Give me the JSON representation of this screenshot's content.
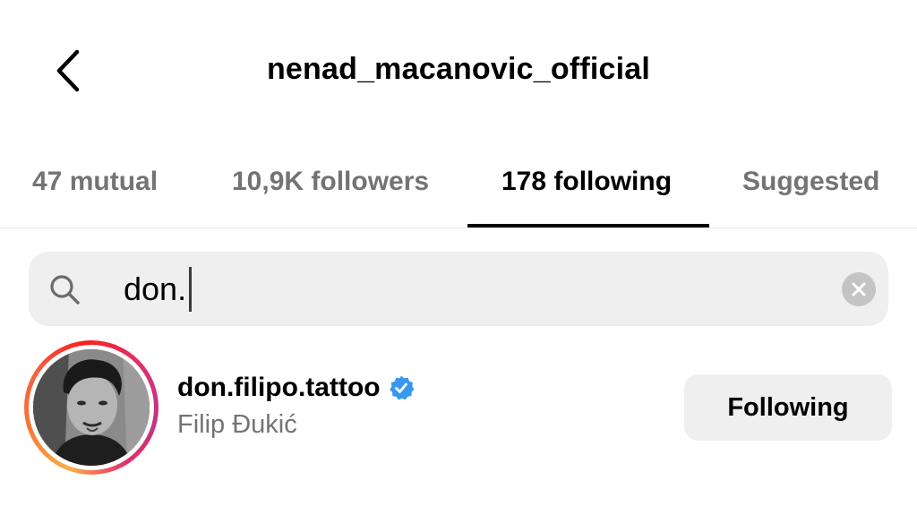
{
  "header": {
    "title": "nenad_macanovic_official",
    "back_icon": "chevron-left-icon"
  },
  "tabs": [
    {
      "label": "47 mutual",
      "active": false
    },
    {
      "label": "10,9K followers",
      "active": false
    },
    {
      "label": "178 following",
      "active": true
    },
    {
      "label": "Suggested",
      "active": false
    }
  ],
  "search": {
    "value": "don.",
    "icon": "search-icon",
    "clear_icon": "clear-icon"
  },
  "results": [
    {
      "username": "don.filipo.tattoo",
      "full_name": "Filip Đukić",
      "verified": true,
      "button_label": "Following"
    }
  ],
  "colors": {
    "verified_badge": "#3897f0",
    "secondary_text": "#737373",
    "button_bg": "#efefef"
  }
}
